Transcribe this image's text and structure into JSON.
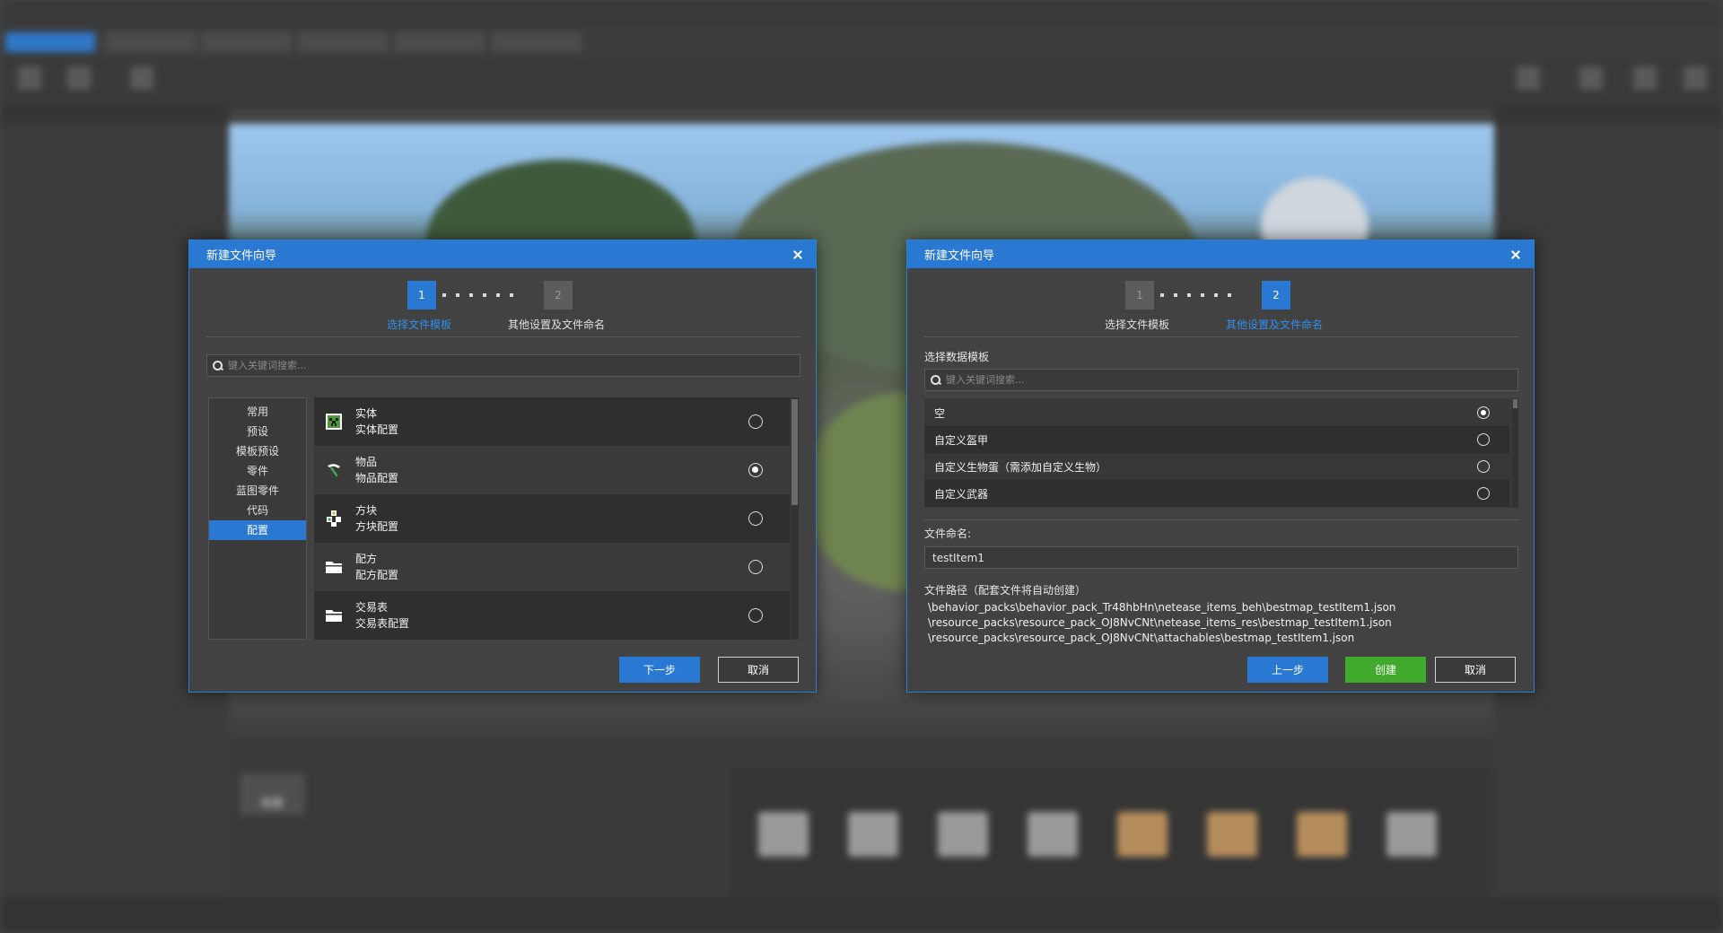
{
  "dialog1": {
    "title": "新建文件向导",
    "steps": [
      {
        "number": "1",
        "label": "选择文件模板"
      },
      {
        "number": "2",
        "label": "其他设置及文件命名"
      }
    ],
    "search_placeholder": "键入关键词搜索...",
    "categories": [
      "常用",
      "预设",
      "模板预设",
      "零件",
      "蓝图零件",
      "代码",
      "配置"
    ],
    "selected_category": "配置",
    "templates": [
      {
        "name": "实体",
        "desc": "实体配置",
        "icon": "creeper-icon",
        "checked": false
      },
      {
        "name": "物品",
        "desc": "物品配置",
        "icon": "pickaxe-icon",
        "checked": true
      },
      {
        "name": "方块",
        "desc": "方块配置",
        "icon": "blocks-icon",
        "checked": false
      },
      {
        "name": "配方",
        "desc": "配方配置",
        "icon": "folder-icon",
        "checked": false
      },
      {
        "name": "交易表",
        "desc": "交易表配置",
        "icon": "folder-icon",
        "checked": false
      }
    ],
    "next_label": "下一步",
    "cancel_label": "取消"
  },
  "dialog2": {
    "title": "新建文件向导",
    "steps": [
      {
        "number": "1",
        "label": "选择文件模板"
      },
      {
        "number": "2",
        "label": "其他设置及文件命名"
      }
    ],
    "data_template_label": "选择数据模板",
    "search_placeholder": "键入关键词搜索...",
    "data_templates": [
      {
        "label": "空",
        "checked": true
      },
      {
        "label": "自定义盔甲",
        "checked": false
      },
      {
        "label": "自定义生物蛋（需添加自定义生物）",
        "checked": false
      },
      {
        "label": "自定义武器",
        "checked": false
      }
    ],
    "file_name_label": "文件命名:",
    "file_name_value": "testItem1",
    "file_path_label": "文件路径（配套文件将自动创建）",
    "file_paths": [
      "\\behavior_packs\\behavior_pack_Tr48hbHn\\netease_items_beh\\bestmap_testItem1.json",
      "\\resource_packs\\resource_pack_OJ8NvCNt\\netease_items_res\\bestmap_testItem1.json",
      "\\resource_packs\\resource_pack_OJ8NvCNt\\attachables\\bestmap_testItem1.json"
    ],
    "prev_label": "上一步",
    "create_label": "创建",
    "cancel_label": "取消"
  },
  "background": {
    "new_button_label": "新建"
  },
  "colors": {
    "accent": "#2978d1",
    "accent_text": "#2f8ff0",
    "create_green": "#3faa2b",
    "dialog_bg": "#424242"
  }
}
